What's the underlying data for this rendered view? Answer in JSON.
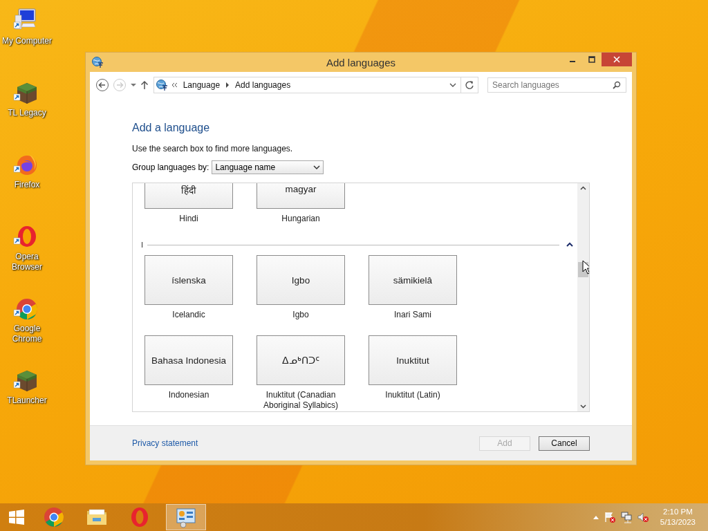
{
  "desktop_icons": [
    {
      "label": "My Computer",
      "kind": "computer"
    },
    {
      "label": "TL Legacy",
      "kind": "block"
    },
    {
      "label": "Firefox",
      "kind": "firefox"
    },
    {
      "label": "Opera Browser",
      "kind": "opera"
    },
    {
      "label": "Google Chrome",
      "kind": "chrome"
    },
    {
      "label": "TLauncher",
      "kind": "block"
    }
  ],
  "window": {
    "title": "Add languages",
    "breadcrumb": [
      "Language",
      "Add languages"
    ],
    "search": {
      "placeholder": "Search languages"
    },
    "heading": "Add a language",
    "instruction": "Use the search box to find more languages.",
    "group_by": {
      "label": "Group languages by:",
      "value": "Language name"
    },
    "groups": [
      {
        "languages": [
          {
            "native": "हिंदी",
            "name": "Hindi"
          },
          {
            "native": "magyar",
            "name": "Hungarian"
          }
        ]
      },
      {
        "letter": "I",
        "expanded": true,
        "languages": [
          {
            "native": "íslenska",
            "name": "Icelandic"
          },
          {
            "native": "Igbo",
            "name": "Igbo"
          },
          {
            "native": "sämikielâ",
            "name": "Inari Sami"
          },
          {
            "native": "Bahasa Indonesia",
            "name": "Indonesian"
          },
          {
            "native": "ᐃᓄᒃᑎᑐᑦ",
            "name": "Inuktitut (Canadian Aboriginal Syllabics)"
          },
          {
            "native": "Inuktitut",
            "name": "Inuktitut (Latin)"
          }
        ]
      }
    ],
    "privacy_link": "Privacy statement",
    "buttons": [
      {
        "label": "Add",
        "disabled": true
      },
      {
        "label": "Cancel",
        "disabled": false
      }
    ]
  },
  "taskbar": {
    "apps": [
      {
        "kind": "chrome",
        "selected": false
      },
      {
        "kind": "folder",
        "selected": false
      },
      {
        "kind": "opera",
        "selected": false
      },
      {
        "kind": "panel",
        "selected": true
      }
    ],
    "time": "2:10 PM",
    "date": "5/13/2023"
  }
}
